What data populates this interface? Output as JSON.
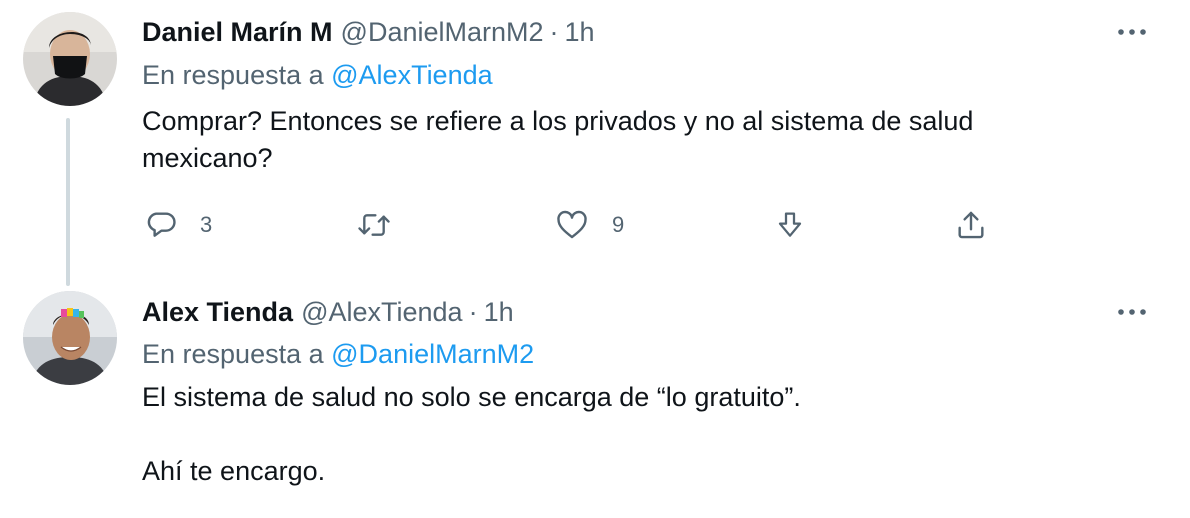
{
  "tweets": [
    {
      "display_name": "Daniel Marín M",
      "handle": "@DanielMarnM2",
      "separator": "·",
      "time": "1h",
      "reply_prefix": "En respuesta a",
      "reply_to": "@AlexTienda",
      "text": [
        "Comprar? Entonces se refiere a los privados y no al sistema de salud",
        "mexicano?"
      ],
      "actions": {
        "reply_count": "3",
        "retweet_count": "",
        "like_count": "9"
      },
      "icons": {
        "more": "more-horizontal-icon",
        "reply": "reply-bubble-icon",
        "retweet": "retweet-icon",
        "like": "heart-icon",
        "share": "share-down-arrow-icon",
        "upload": "upload-icon"
      }
    },
    {
      "display_name": "Alex Tienda",
      "handle": "@AlexTienda",
      "separator": "·",
      "time": "1h",
      "reply_prefix": "En respuesta a",
      "reply_to": "@DanielMarnM2",
      "paragraphs": [
        "El sistema de salud no solo se encarga de “lo gratuito”.",
        "Ahí te encargo."
      ],
      "icons": {
        "more": "more-horizontal-icon"
      }
    }
  ],
  "colors": {
    "text_primary": "#0f1419",
    "text_secondary": "#536471",
    "link": "#1d9bf0",
    "thread_line": "#cfd9de"
  }
}
